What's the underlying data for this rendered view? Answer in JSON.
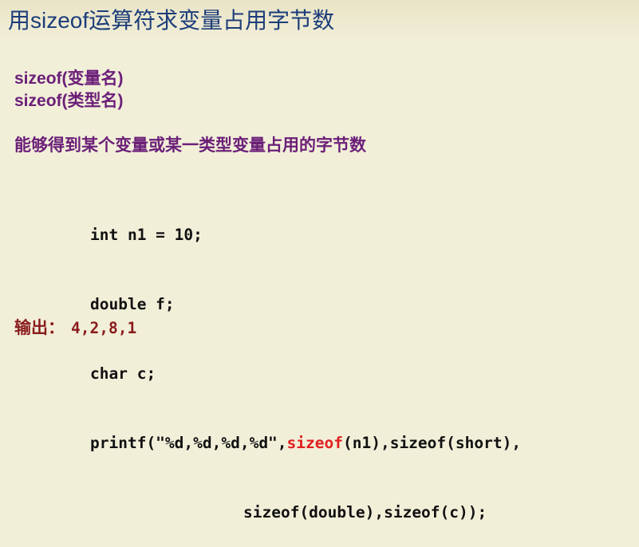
{
  "title": "用sizeof运算符求变量占用字节数",
  "syntax": [
    "sizeof(变量名)",
    "sizeof(类型名)"
  ],
  "description": "能够得到某个变量或某一类型变量占用的字节数",
  "code": {
    "line1": "int n1 = 10;",
    "line2": "double f;",
    "line3": "char c;",
    "line4_pre": "printf(\"%d,%d,%d,%d\",",
    "line4_highlight": "sizeof",
    "line4_post": "(n1),sizeof(short),",
    "line5": "sizeof(double),sizeof(c));"
  },
  "output": {
    "label": "输出：",
    "value": "4,2,8,1"
  },
  "colors": {
    "title": "#1c3d7a",
    "syntax": "#6b1f78",
    "highlight": "#e02020",
    "output": "#8a1c1c",
    "background": "#f2efd9"
  }
}
